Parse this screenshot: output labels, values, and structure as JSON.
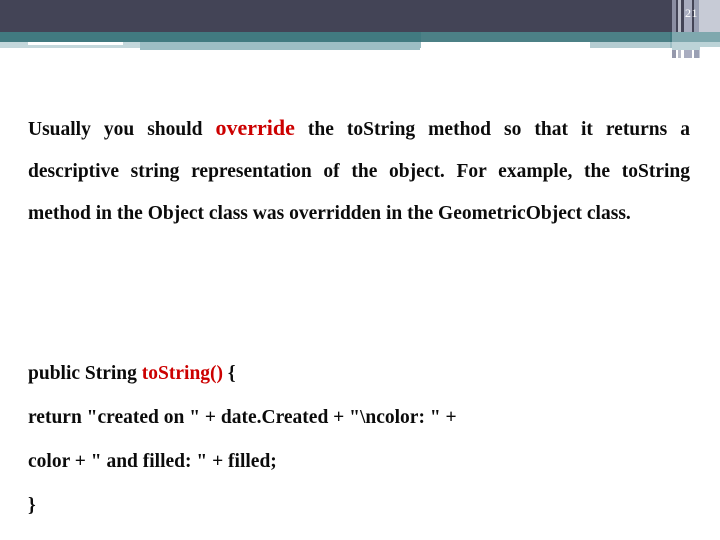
{
  "header": {
    "slide_number": "21",
    "colors": {
      "dark_band": "#434456",
      "teal_band": "#417a80",
      "pale_band": "#9dbec4",
      "stripe_gray": "#a9adc0"
    }
  },
  "prose": {
    "seg1": "Usually you should ",
    "highlight1": "override",
    "seg2": " the toString method so that it returns a descriptive string representation of the object. For example, the toString method in the Object class was overridden in the GeometricObject class."
  },
  "code": {
    "lines": [
      {
        "pre": "public String ",
        "red": "toString()",
        "post": " {"
      },
      {
        "pre": "return \"created on \" + date.Created + \"\\ncolor: \" +",
        "red": "",
        "post": ""
      },
      {
        "pre": "color + \" and filled: \" + filled;",
        "red": "",
        "post": ""
      },
      {
        "pre": "}",
        "red": "",
        "post": ""
      }
    ]
  },
  "accent_color": "#cc0000"
}
